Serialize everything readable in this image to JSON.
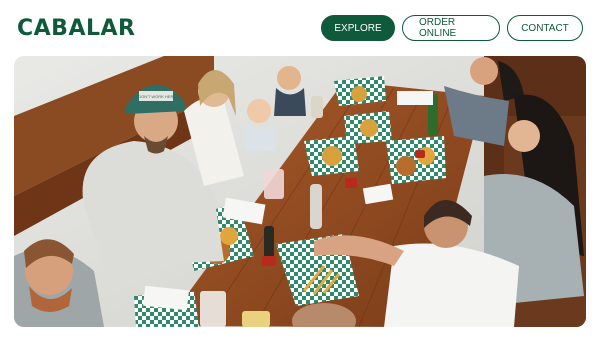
{
  "brand": {
    "name": "CABALAR",
    "color": "#0f5a3a"
  },
  "nav": {
    "items": [
      {
        "label": "EXPLORE",
        "active": true
      },
      {
        "label": "ORDER ONLINE",
        "active": false
      },
      {
        "label": "CONTACT",
        "active": false
      }
    ]
  },
  "hero": {
    "cap_text": "I DON'T WORK HERE"
  }
}
